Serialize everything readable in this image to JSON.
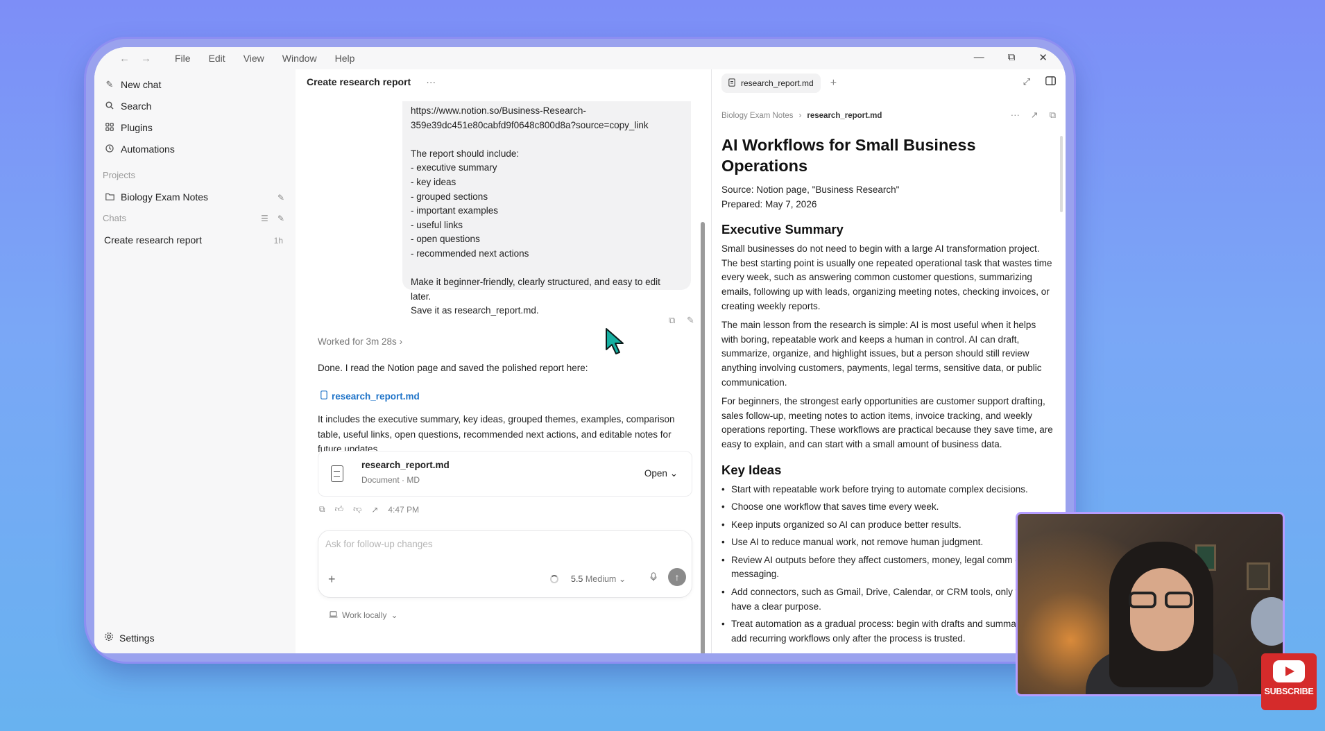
{
  "menu": {
    "nav_back": "←",
    "nav_forward": "→",
    "items": [
      "File",
      "Edit",
      "View",
      "Window",
      "Help"
    ],
    "minimize": "—",
    "maximize": "⧉",
    "close": "✕"
  },
  "sidebar": {
    "new_chat": "New chat",
    "search": "Search",
    "plugins": "Plugins",
    "automations": "Automations",
    "projects_label": "Projects",
    "project_item": "Biology Exam Notes",
    "chats_label": "Chats",
    "chat_item": "Create research report",
    "chat_item_time": "1h",
    "settings": "Settings"
  },
  "chat": {
    "title": "Create research report",
    "title_menu": "···",
    "user_message": {
      "url_line1": "https://www.notion.so/Business-Research-",
      "url_line2": "359e39dc451e80cabfd9f0648c800d8a?source=copy_link",
      "intro": "The report should include:",
      "list": [
        "- executive summary",
        "- key ideas",
        "- grouped sections",
        "- important examples",
        "- useful links",
        "- open questions",
        "- recommended next actions"
      ],
      "closing_line1": "Make it beginner-friendly, clearly structured, and easy to edit",
      "closing_line2": "later.",
      "closing_line3": "Save it as research_report.md."
    },
    "worked_for": "Worked for 3m 28s",
    "worked_chevron": "›",
    "reply_intro": "Done. I read the Notion page and saved the polished report here:",
    "file_link": "research_report.md",
    "reply_body_line1": "It includes the executive summary, key ideas, grouped themes, examples, comparison",
    "reply_body_line2": "table, useful links, open questions, recommended next actions, and editable notes for",
    "reply_body_line3": "future updates.",
    "file_card": {
      "name": "research_report.md",
      "meta": "Document · MD",
      "open_label": "Open",
      "open_chevron": "⌄"
    },
    "message_time": "4:47 PM",
    "composer": {
      "placeholder": "Ask for follow-up changes",
      "plus": "+",
      "model": "5.5",
      "model_effort": "Medium",
      "model_chevron": "⌄",
      "send": "↑"
    },
    "work_locally": "Work locally",
    "work_locally_chevron": "⌄"
  },
  "document": {
    "tab_name": "research_report.md",
    "tab_add": "+",
    "breadcrumb_parent": "Biology Exam Notes",
    "breadcrumb_sep": "›",
    "breadcrumb_current": "research_report.md",
    "title": "AI Workflows for Small Business Operations",
    "source": "Source: Notion page, \"Business Research\"",
    "prepared": "Prepared: May 7, 2026",
    "h_exec": "Executive Summary",
    "exec_p1": "Small businesses do not need to begin with a large AI transformation project. The best starting point is usually one repeated operational task that wastes time every week, such as answering common customer questions, summarizing emails, following up with leads, organizing meeting notes, checking invoices, or creating weekly reports.",
    "exec_p2": "The main lesson from the research is simple: AI is most useful when it helps with boring, repeatable work and keeps a human in control. AI can draft, summarize, organize, and highlight issues, but a person should still review anything involving customers, payments, legal terms, sensitive data, or public communication.",
    "exec_p3": "For beginners, the strongest early opportunities are customer support drafting, sales follow-up, meeting notes to action items, invoice tracking, and weekly operations reporting. These workflows are practical because they save time, are easy to explain, and can start with a small amount of business data.",
    "h_key": "Key Ideas",
    "key_ideas": [
      "Start with repeatable work before trying to automate complex decisions.",
      "Choose one workflow that saves time every week.",
      "Keep inputs organized so AI can produce better results.",
      "Use AI to reduce manual work, not remove human judgment.",
      "Review AI outputs before they affect customers, money, legal comm or public messaging.",
      "Add connectors, such as Gmail, Drive, Calendar, or CRM tools, only v they have a clear purpose.",
      "Treat automation as a gradual process: begin with drafts and summa then add recurring workflows only after the process is trusted."
    ]
  },
  "overlay": {
    "subscribe": "SUBSCRIBE"
  }
}
